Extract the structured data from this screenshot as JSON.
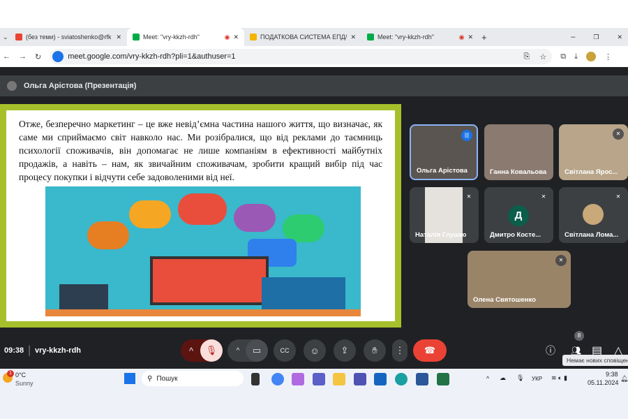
{
  "browser": {
    "tabs": [
      {
        "label": "(без теми) - sviatoshenko@rfk",
        "icon": "gmail-icon",
        "color": "#ea4335"
      },
      {
        "label": "Meet: \"vry-kkzh-rdh\"",
        "icon": "meet-icon",
        "color": "#00ac47",
        "active": true
      },
      {
        "label": "ПОДАТКОВА СИСТЕМА ЕПД/",
        "icon": "slides-icon",
        "color": "#f4b400"
      },
      {
        "label": "Meet: \"vry-kkzh-rdh\"",
        "icon": "meet-icon",
        "color": "#00ac47"
      }
    ],
    "url": "meet.google.com/vry-kkzh-rdh?pli=1&authuser=1"
  },
  "presenter": "Ольга Арістова (Презентація)",
  "slide": {
    "text": "Отже, безперечно маркетинг – це вже невід’ємна частина нашого життя, що визначає, як саме ми сприймаємо світ навколо нас. Ми розібралися, що від реклами до таємниць психології споживачів, він допомагає не лише компаніям в ефективності майбутніх продажів, а навіть – нам, як звичайним споживачам, зробити кращий вибір під час процесу покупки і відчути себе задоволеними від неї."
  },
  "participants": [
    {
      "name": "Ольга Арістова",
      "speaking": true
    },
    {
      "name": "Ганна Ковальова"
    },
    {
      "name": "Світлана Ярос..."
    },
    {
      "name": "Наталія Глушко"
    },
    {
      "name": "Дмитро Косте...",
      "initial": "Д"
    },
    {
      "name": "Світлана Лома..."
    },
    {
      "name": "Олена Святошенко"
    }
  ],
  "meeting": {
    "time": "09:38",
    "code": "vry-kkzh-rdh",
    "people_count": "8",
    "tooltip": "Немає нових сповіщень"
  },
  "taskbar": {
    "temp": "0°C",
    "weather": "Sunny",
    "badge": "1",
    "search": "Пошук",
    "lang": "УКР",
    "clock": "9:38",
    "date": "05.11.2024"
  }
}
